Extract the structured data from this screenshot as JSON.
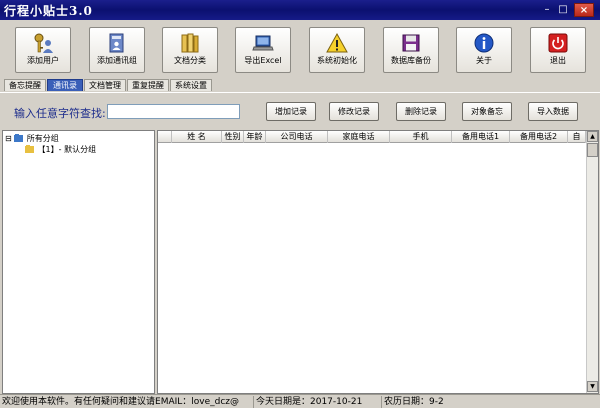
{
  "window": {
    "title": "行程小贴士3.0",
    "minimize": "–",
    "maximize": "□",
    "close": "×"
  },
  "toolbar": [
    {
      "label": "添加用户",
      "icon": "keys-user-icon"
    },
    {
      "label": "添加通讯组",
      "icon": "contact-book-icon"
    },
    {
      "label": "文档分类",
      "icon": "folders-icon"
    },
    {
      "label": "导出Excel",
      "icon": "laptop-export-icon"
    },
    {
      "label": "系统初始化",
      "icon": "warning-icon"
    },
    {
      "label": "数据库备份",
      "icon": "floppy-disk-icon"
    },
    {
      "label": "关于",
      "icon": "info-icon"
    },
    {
      "label": "退出",
      "icon": "power-icon"
    }
  ],
  "tabs": [
    {
      "label": "备忘提醒",
      "active": false
    },
    {
      "label": "通讯录",
      "active": true
    },
    {
      "label": "文档管理",
      "active": false
    },
    {
      "label": "重复提醒",
      "active": false
    },
    {
      "label": "系统设置",
      "active": false
    }
  ],
  "search": {
    "label": "输入任意字符查找:",
    "value": ""
  },
  "actions": [
    "增加记录",
    "修改记录",
    "删除记录",
    "对象备忘",
    "导入数据"
  ],
  "tree": {
    "expander": "⊟",
    "root": "所有分组",
    "child": "【1】- 默认分组"
  },
  "grid": {
    "columns": [
      "",
      "姓 名",
      "性别",
      "年龄",
      "公司电话",
      "家庭电话",
      "手机",
      "备用电话1",
      "备用电话2",
      "自"
    ],
    "rows": []
  },
  "status": {
    "welcome": "欢迎使用本软件。有任何疑问和建议请EMAIL：love_dcz@",
    "today": "今天日期是：2017-10-21",
    "lunar": "农历日期：9-2"
  },
  "colors": {
    "titlebar": "#0b1070",
    "active_tab": "#3a5fb8",
    "label_text": "#1c2c8c"
  }
}
